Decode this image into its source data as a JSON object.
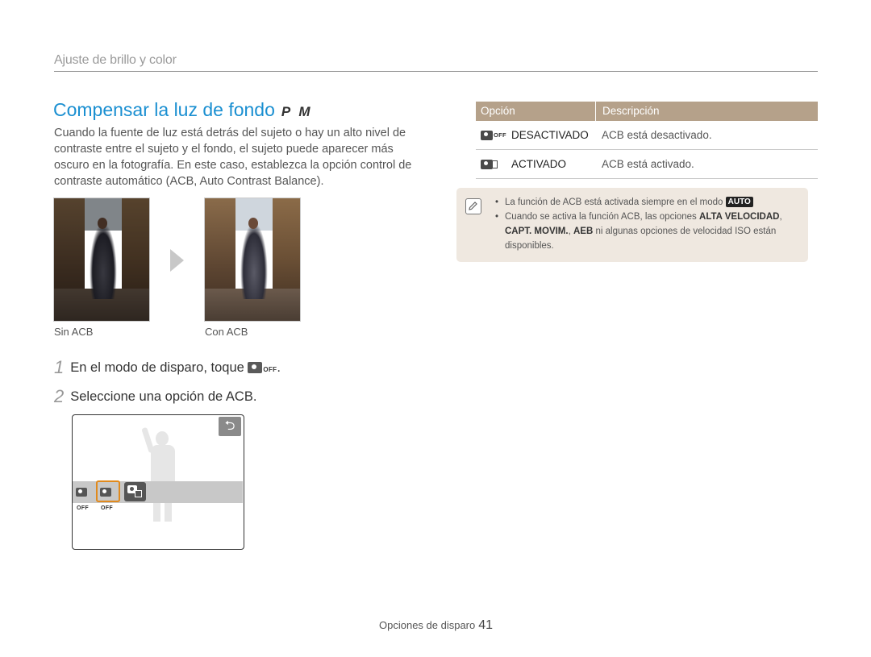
{
  "header": {
    "section": "Ajuste de brillo y color"
  },
  "title": {
    "text": "Compensar la luz de fondo",
    "modes": "P M"
  },
  "intro": "Cuando la fuente de luz está detrás del sujeto o hay un alto nivel de contraste entre el sujeto y el fondo, el sujeto puede aparecer más oscuro en la fotografía. En este caso, establezca la opción control de contraste automático (ACB, Auto Contrast Balance).",
  "photos": {
    "left_caption": "Sin ACB",
    "right_caption": "Con ACB"
  },
  "steps": [
    {
      "num": "1",
      "text": "En el modo de disparo, toque",
      "suffix": "."
    },
    {
      "num": "2",
      "text": "Seleccione una opción de ACB."
    }
  ],
  "icon_off_text": "OFF",
  "screen": {
    "back_glyph": "⮌"
  },
  "table": {
    "headers": [
      "Opción",
      "Descripción"
    ],
    "rows": [
      {
        "option": "DESACTIVADO",
        "description": "ACB está desactivado."
      },
      {
        "option": "ACTIVADO",
        "description": "ACB está activado."
      }
    ]
  },
  "note": {
    "item1_text": "La función de ACB está activada siempre en el modo",
    "item1_badge": "AUTO",
    "item2_pre": "Cuando se activa la función ACB, las opciones",
    "item2_b1": "ALTA VELOCIDAD",
    "item2_sep1": ",",
    "item2_b2": "CAPT. MOVIM.",
    "item2_sep2": ",",
    "item2_b3": "AEB",
    "item2_post": "ni algunas opciones de velocidad ISO están disponibles."
  },
  "footer": {
    "label": "Opciones de disparo",
    "page": "41"
  }
}
